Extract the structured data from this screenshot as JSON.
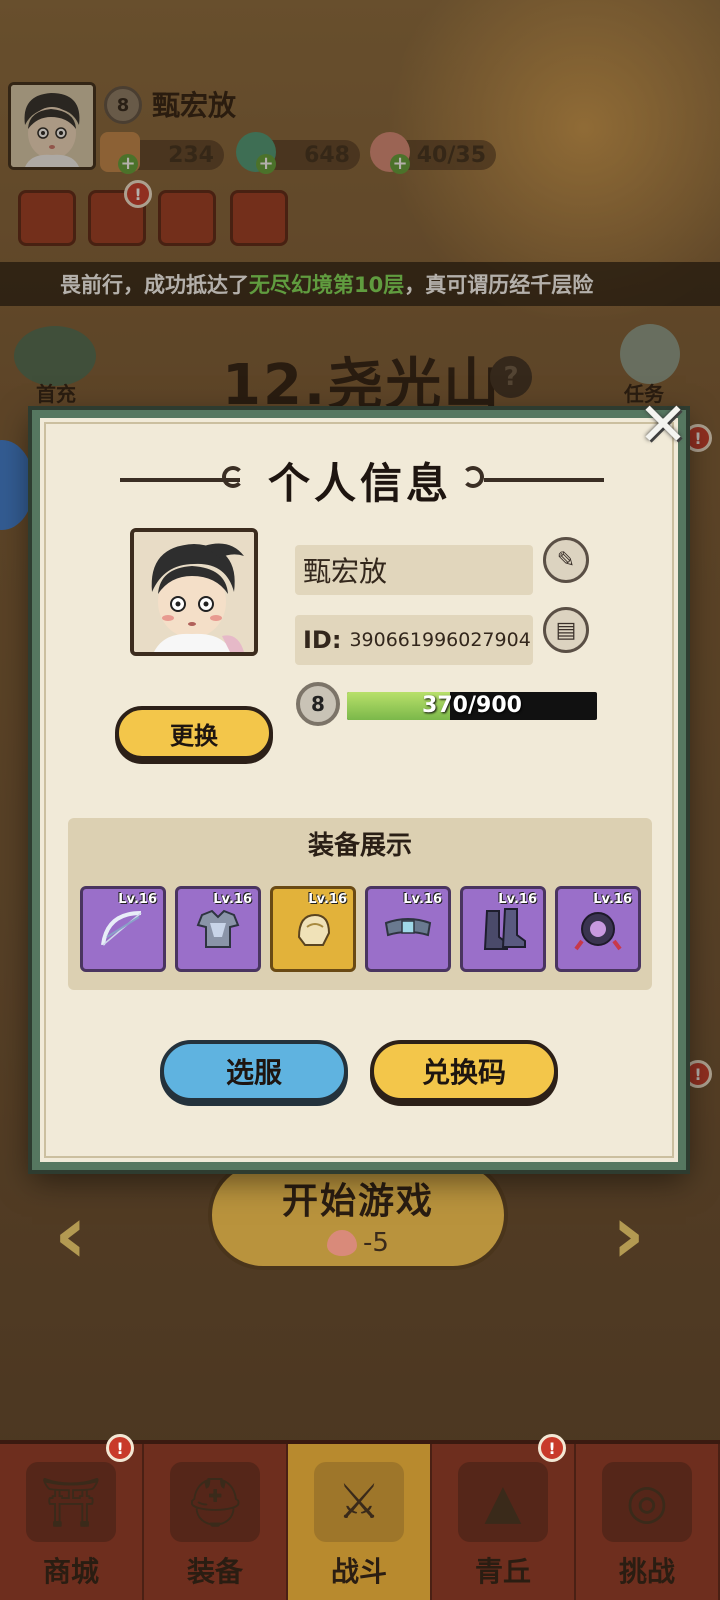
{
  "header": {
    "level": "8",
    "player_name": "甄宏放",
    "resources": [
      {
        "name": "scroll-currency",
        "value": "234"
      },
      {
        "name": "jade-currency",
        "value": "648"
      },
      {
        "name": "peach-stamina",
        "value": "40/35"
      }
    ]
  },
  "marquee": {
    "before": "畏前行，成功抵达了",
    "highlight": "无尽幻境第10层",
    "after": "，真可谓历经千层险"
  },
  "stage": {
    "title": "12.尧光山",
    "help": "?"
  },
  "side": {
    "first_charge": "首充",
    "task": "任务"
  },
  "dialog": {
    "title": "个人信息",
    "player_name": "甄宏放",
    "id_label": "ID:",
    "id_value": "390661996027904",
    "level": "8",
    "exp_text": "370/900",
    "exp_current": 370,
    "exp_max": 900,
    "change_label": "更换",
    "equip_title": "装备展示",
    "equipment": [
      {
        "name": "bow",
        "level": "Lv.16",
        "rarity": "purple"
      },
      {
        "name": "armor",
        "level": "Lv.16",
        "rarity": "purple"
      },
      {
        "name": "helmet",
        "level": "Lv.16",
        "rarity": "gold"
      },
      {
        "name": "belt",
        "level": "Lv.16",
        "rarity": "purple"
      },
      {
        "name": "boots",
        "level": "Lv.16",
        "rarity": "purple"
      },
      {
        "name": "amulet",
        "level": "Lv.16",
        "rarity": "purple"
      }
    ],
    "server_label": "选服",
    "code_label": "兑换码",
    "close": "✕"
  },
  "start": {
    "label": "开始游戏",
    "cost": "-5"
  },
  "nav": [
    {
      "label": "商城",
      "icon": "shop-icon",
      "active": false,
      "badge": "!"
    },
    {
      "label": "装备",
      "icon": "helmet-icon",
      "active": false
    },
    {
      "label": "战斗",
      "icon": "crossed-swords-icon",
      "active": true
    },
    {
      "label": "青丘",
      "icon": "mountain-icon",
      "active": false,
      "badge": "!"
    },
    {
      "label": "挑战",
      "icon": "orb-icon",
      "active": false
    }
  ],
  "colors": {
    "dialog_border": "#567760",
    "exp_fill": "#8bc34a",
    "button_yellow": "#f3c64a",
    "button_blue": "#5fb3e0",
    "equip_purple": "#9a6fc9",
    "equip_gold": "#e2b23a",
    "marquee_highlight": "#7fe05a"
  }
}
